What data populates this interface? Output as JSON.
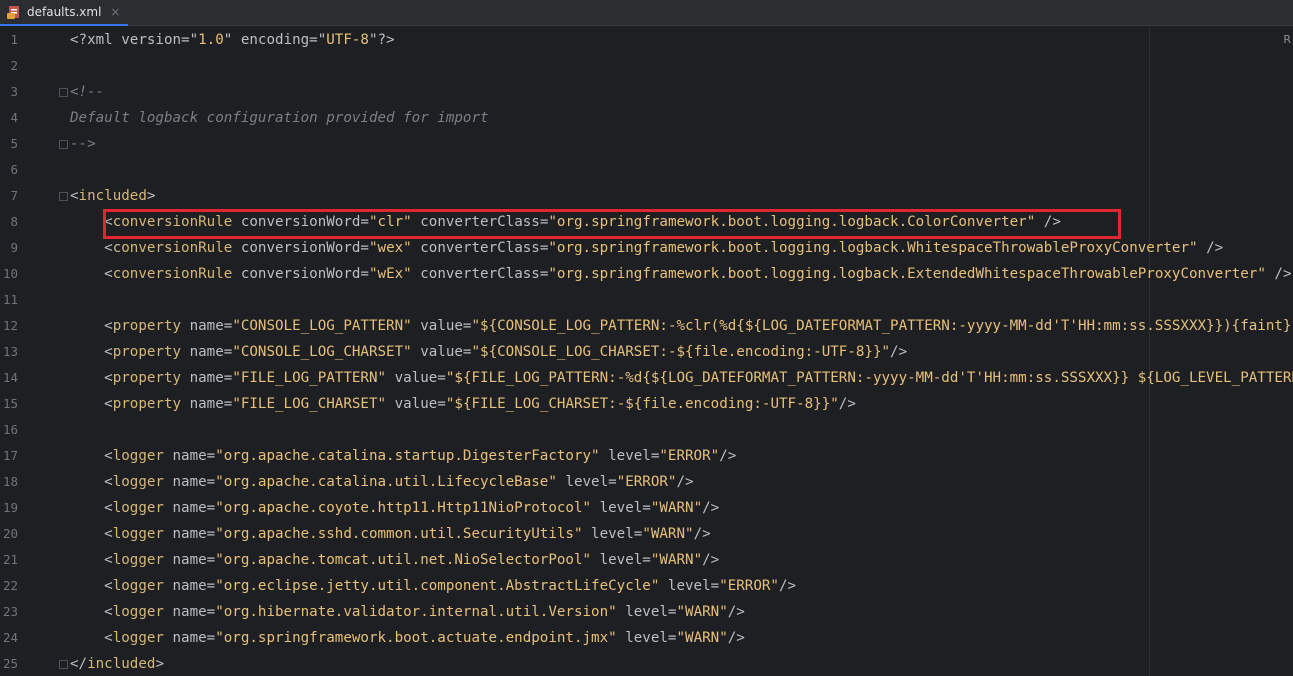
{
  "tab": {
    "filename": "defaults.xml",
    "close_glyph": "×",
    "icon": "xml-file-icon"
  },
  "reader_mode_label": "R",
  "colors": {
    "tag": "#d5b778",
    "string": "#e6c07b",
    "comment": "#7a7e85",
    "highlight": "#e0262e"
  },
  "lines": [
    {
      "n": "1",
      "parts": [
        [
          "punct",
          "<?xml version=\""
        ],
        [
          "val",
          "1.0"
        ],
        [
          "punct",
          "\" encoding=\""
        ],
        [
          "val",
          "UTF-8"
        ],
        [
          "punct",
          "\"?>"
        ]
      ]
    },
    {
      "n": "2",
      "parts": []
    },
    {
      "n": "3",
      "parts": [
        [
          "comment",
          "<!--"
        ]
      ]
    },
    {
      "n": "4",
      "parts": [
        [
          "comment",
          "Default logback configuration provided for import"
        ]
      ]
    },
    {
      "n": "5",
      "parts": [
        [
          "comment",
          "-->"
        ]
      ]
    },
    {
      "n": "6",
      "parts": []
    },
    {
      "n": "7",
      "parts": [
        [
          "punct",
          "<"
        ],
        [
          "tag",
          "included"
        ],
        [
          "punct",
          ">"
        ]
      ]
    },
    {
      "n": "8",
      "parts": [
        [
          "punct",
          "    <"
        ],
        [
          "tag",
          "conversionRule"
        ],
        [
          "attr",
          " conversionWord="
        ],
        [
          "val",
          "\"clr\""
        ],
        [
          "attr",
          " converterClass="
        ],
        [
          "val",
          "\"org.springframework.boot.logging.logback.ColorConverter\""
        ],
        [
          "punct",
          " />"
        ]
      ]
    },
    {
      "n": "9",
      "parts": [
        [
          "punct",
          "    <"
        ],
        [
          "tag",
          "conversionRule"
        ],
        [
          "attr",
          " conversionWord="
        ],
        [
          "val",
          "\"wex\""
        ],
        [
          "attr",
          " converterClass="
        ],
        [
          "val",
          "\"org.springframework.boot.logging.logback.WhitespaceThrowableProxyConverter\""
        ],
        [
          "punct",
          " />"
        ]
      ]
    },
    {
      "n": "10",
      "parts": [
        [
          "punct",
          "    <"
        ],
        [
          "tag",
          "conversionRule"
        ],
        [
          "attr",
          " conversionWord="
        ],
        [
          "val",
          "\"wEx\""
        ],
        [
          "attr",
          " converterClass="
        ],
        [
          "val",
          "\"org.springframework.boot.logging.logback.ExtendedWhitespaceThrowableProxyConverter\""
        ],
        [
          "punct",
          " />"
        ]
      ]
    },
    {
      "n": "11",
      "parts": []
    },
    {
      "n": "12",
      "parts": [
        [
          "punct",
          "    <"
        ],
        [
          "tag",
          "property"
        ],
        [
          "attr",
          " name="
        ],
        [
          "val",
          "\"CONSOLE_LOG_PATTERN\""
        ],
        [
          "attr",
          " value="
        ],
        [
          "val",
          "\"${CONSOLE_LOG_PATTERN:-%clr(%d{${LOG_DATEFORMAT_PATTERN:-yyyy-MM-dd'T'HH:mm:ss.SSSXXX}}){faint}"
        ]
      ]
    },
    {
      "n": "13",
      "parts": [
        [
          "punct",
          "    <"
        ],
        [
          "tag",
          "property"
        ],
        [
          "attr",
          " name="
        ],
        [
          "val",
          "\"CONSOLE_LOG_CHARSET\""
        ],
        [
          "attr",
          " value="
        ],
        [
          "val",
          "\"${CONSOLE_LOG_CHARSET:-${file.encoding:-UTF-8}}\""
        ],
        [
          "punct",
          "/>"
        ]
      ]
    },
    {
      "n": "14",
      "parts": [
        [
          "punct",
          "    <"
        ],
        [
          "tag",
          "property"
        ],
        [
          "attr",
          " name="
        ],
        [
          "val",
          "\"FILE_LOG_PATTERN\""
        ],
        [
          "attr",
          " value="
        ],
        [
          "val",
          "\"${FILE_LOG_PATTERN:-%d{${LOG_DATEFORMAT_PATTERN:-yyyy-MM-dd'T'HH:mm:ss.SSSXXX}} ${LOG_LEVEL_PATTERN"
        ]
      ]
    },
    {
      "n": "15",
      "parts": [
        [
          "punct",
          "    <"
        ],
        [
          "tag",
          "property"
        ],
        [
          "attr",
          " name="
        ],
        [
          "val",
          "\"FILE_LOG_CHARSET\""
        ],
        [
          "attr",
          " value="
        ],
        [
          "val",
          "\"${FILE_LOG_CHARSET:-${file.encoding:-UTF-8}}\""
        ],
        [
          "punct",
          "/>"
        ]
      ]
    },
    {
      "n": "16",
      "parts": []
    },
    {
      "n": "17",
      "parts": [
        [
          "punct",
          "    <"
        ],
        [
          "tag",
          "logger"
        ],
        [
          "attr",
          " name="
        ],
        [
          "val",
          "\"org.apache.catalina.startup.DigesterFactory\""
        ],
        [
          "attr",
          " level="
        ],
        [
          "val",
          "\"ERROR\""
        ],
        [
          "punct",
          "/>"
        ]
      ]
    },
    {
      "n": "18",
      "parts": [
        [
          "punct",
          "    <"
        ],
        [
          "tag",
          "logger"
        ],
        [
          "attr",
          " name="
        ],
        [
          "val",
          "\"org.apache.catalina.util.LifecycleBase\""
        ],
        [
          "attr",
          " level="
        ],
        [
          "val",
          "\"ERROR\""
        ],
        [
          "punct",
          "/>"
        ]
      ]
    },
    {
      "n": "19",
      "parts": [
        [
          "punct",
          "    <"
        ],
        [
          "tag",
          "logger"
        ],
        [
          "attr",
          " name="
        ],
        [
          "val",
          "\"org.apache.coyote.http11.Http11NioProtocol\""
        ],
        [
          "attr",
          " level="
        ],
        [
          "val",
          "\"WARN\""
        ],
        [
          "punct",
          "/>"
        ]
      ]
    },
    {
      "n": "20",
      "parts": [
        [
          "punct",
          "    <"
        ],
        [
          "tag",
          "logger"
        ],
        [
          "attr",
          " name="
        ],
        [
          "val",
          "\"org.apache.sshd.common.util.SecurityUtils\""
        ],
        [
          "attr",
          " level="
        ],
        [
          "val",
          "\"WARN\""
        ],
        [
          "punct",
          "/>"
        ]
      ]
    },
    {
      "n": "21",
      "parts": [
        [
          "punct",
          "    <"
        ],
        [
          "tag",
          "logger"
        ],
        [
          "attr",
          " name="
        ],
        [
          "val",
          "\"org.apache.tomcat.util.net.NioSelectorPool\""
        ],
        [
          "attr",
          " level="
        ],
        [
          "val",
          "\"WARN\""
        ],
        [
          "punct",
          "/>"
        ]
      ]
    },
    {
      "n": "22",
      "parts": [
        [
          "punct",
          "    <"
        ],
        [
          "tag",
          "logger"
        ],
        [
          "attr",
          " name="
        ],
        [
          "val",
          "\"org.eclipse.jetty.util.component.AbstractLifeCycle\""
        ],
        [
          "attr",
          " level="
        ],
        [
          "val",
          "\"ERROR\""
        ],
        [
          "punct",
          "/>"
        ]
      ]
    },
    {
      "n": "23",
      "parts": [
        [
          "punct",
          "    <"
        ],
        [
          "tag",
          "logger"
        ],
        [
          "attr",
          " name="
        ],
        [
          "val",
          "\"org.hibernate.validator.internal.util.Version\""
        ],
        [
          "attr",
          " level="
        ],
        [
          "val",
          "\"WARN\""
        ],
        [
          "punct",
          "/>"
        ]
      ]
    },
    {
      "n": "24",
      "parts": [
        [
          "punct",
          "    <"
        ],
        [
          "tag",
          "logger"
        ],
        [
          "attr",
          " name="
        ],
        [
          "val",
          "\"org.springframework.boot.actuate.endpoint.jmx\""
        ],
        [
          "attr",
          " level="
        ],
        [
          "val",
          "\"WARN\""
        ],
        [
          "punct",
          "/>"
        ]
      ]
    },
    {
      "n": "25",
      "parts": [
        [
          "punct",
          "</"
        ],
        [
          "tag",
          "included"
        ],
        [
          "punct",
          ">"
        ]
      ]
    }
  ]
}
